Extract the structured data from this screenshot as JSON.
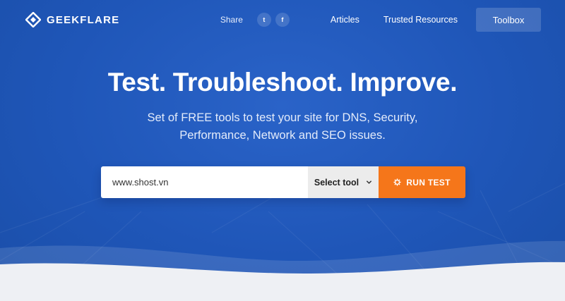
{
  "header": {
    "logo_text": "GEEKFLARE",
    "share_label": "Share",
    "social": [
      {
        "icon": "twitter-icon",
        "glyph": "t"
      },
      {
        "icon": "facebook-icon",
        "glyph": "f"
      }
    ],
    "nav": {
      "articles": "Articles",
      "trusted_resources": "Trusted Resources",
      "toolbox": "Toolbox"
    }
  },
  "hero": {
    "title": "Test. Troubleshoot. Improve.",
    "subtitle_line1": "Set of FREE tools to test your site for DNS, Security,",
    "subtitle_line2": "Performance, Network and SEO issues."
  },
  "search": {
    "url_value": "www.shost.vn",
    "select_label": "Select tool",
    "run_label": "RUN TEST"
  },
  "colors": {
    "background": "#1f56b8",
    "accent": "#f5761a",
    "select_bg": "#ececec"
  }
}
